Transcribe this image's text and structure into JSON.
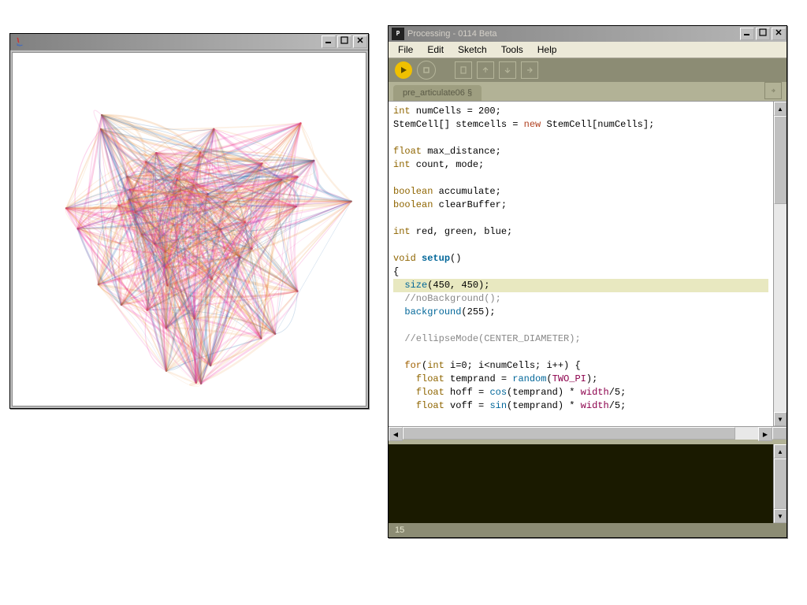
{
  "sketch_window": {
    "title": ""
  },
  "ide_window": {
    "title": "Processing - 0114 Beta",
    "menu": [
      "File",
      "Edit",
      "Sketch",
      "Tools",
      "Help"
    ],
    "tab_label": "pre_articulate06 §",
    "status_line": "15",
    "code": {
      "l01a": "int",
      "l01b": " numCells = 200;",
      "l02a": "StemCell[] stemcells = ",
      "l02b": "new",
      "l02c": " StemCell[numCells];",
      "l03": "",
      "l04a": "float",
      "l04b": " max_distance;",
      "l05a": "int",
      "l05b": " count, mode;",
      "l06": "",
      "l07a": "boolean",
      "l07b": " accumulate;",
      "l08a": "boolean",
      "l08b": " clearBuffer;",
      "l09": "",
      "l10a": "int",
      "l10b": " red, green, blue;",
      "l11": "",
      "l12a": "void",
      "l12b": " ",
      "l12c": "setup",
      "l12d": "()",
      "l13": "{",
      "l14a": "  ",
      "l14b": "size",
      "l14c": "(450, 450);",
      "l15a": "  ",
      "l15b": "//noBackground();",
      "l16a": "  ",
      "l16b": "background",
      "l16c": "(255);",
      "l17": "",
      "l18a": "  ",
      "l18b": "//ellipseMode(CENTER_DIAMETER);",
      "l19": "",
      "l20a": "  ",
      "l20b": "for",
      "l20c": "(",
      "l20d": "int",
      "l20e": " i=0; i<numCells; i++) {",
      "l21a": "    ",
      "l21b": "float",
      "l21c": " temprand = ",
      "l21d": "random",
      "l21e": "(",
      "l21f": "TWO_PI",
      "l21g": ");",
      "l22a": "    ",
      "l22b": "float",
      "l22c": " hoff = ",
      "l22d": "cos",
      "l22e": "(temprand) * ",
      "l22f": "width",
      "l22g": "/5;",
      "l23a": "    ",
      "l23b": "float",
      "l23c": " voff = ",
      "l23d": "sin",
      "l23e": "(temprand) * ",
      "l23f": "width",
      "l23g": "/5;"
    }
  }
}
